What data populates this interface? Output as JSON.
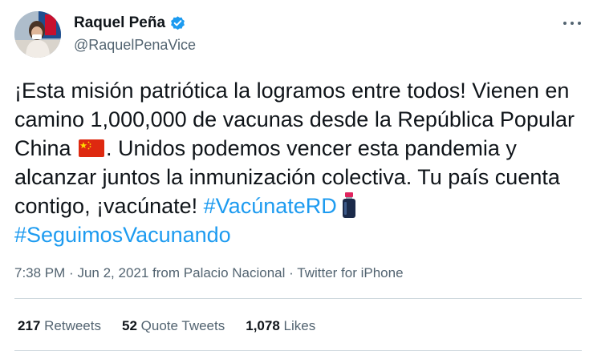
{
  "author": {
    "name": "Raquel Peña",
    "handle": "@RaquelPenaVice",
    "verified": true
  },
  "tweet": {
    "text_part1": "¡Esta misión patriótica la logramos entre todos! Vienen en camino 1,000,000 de vacunas desde la República Popular China ",
    "flag_icon": "china-flag-emoji",
    "text_part2": ". Unidos podemos vencer esta pandemia y alcanzar juntos la inmunización colectiva. Tu país cuenta contigo, ¡vacúnate! ",
    "hashtag1": "#VacúnateRD",
    "vial_icon": "vaccine-vial-emoji",
    "hashtag2": "#SeguimosVacunando"
  },
  "meta": {
    "time": "7:38 PM",
    "date": "Jun 2, 2021",
    "from_label": "from",
    "location": "Palacio Nacional",
    "separator": "·",
    "source": "Twitter for iPhone"
  },
  "stats": {
    "retweets_count": "217",
    "retweets_label": "Retweets",
    "quotes_count": "52",
    "quotes_label": "Quote Tweets",
    "likes_count": "1,078",
    "likes_label": "Likes"
  },
  "colors": {
    "link": "#1d9bf0",
    "text": "#0f1419",
    "secondary": "#536471",
    "verified": "#1d9bf0"
  }
}
